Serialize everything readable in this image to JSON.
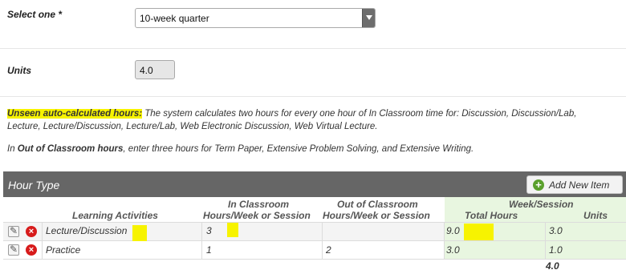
{
  "form": {
    "select_label": "Select one *",
    "select_value": "10-week quarter",
    "units_label": "Units",
    "units_value": "4.0"
  },
  "notes": {
    "unseen_title": "Unseen auto-calculated hours:",
    "unseen_line1": " The system calculates two hours for every one hour of In Classroom time for: Discussion, Discussion/Lab,",
    "unseen_line2": "Lecture, Lecture/Discussion, Lecture/Lab, Web Electronic Discussion, Web Virtual Lecture.",
    "out_prefix": "In ",
    "out_bold": "Out of Classroom hours",
    "out_rest": ", enter three hours for Term Paper, Extensive Problem Solving, and Extensive Writing."
  },
  "table": {
    "title": "Hour Type",
    "add_button": "Add New Item",
    "headers": {
      "learning": "Learning Activities",
      "in_class_1": "In Classroom",
      "in_class_2": "Hours/Week or Session",
      "out_class_1": "Out of Classroom",
      "out_class_2": "Hours/Week or Session",
      "total_1": "Week/Session",
      "total_2": "Total Hours",
      "units": "Units"
    },
    "rows": [
      {
        "activity": "Lecture/Discussion",
        "in_class": "3",
        "out_class": "",
        "total": "9.0",
        "units": "3.0"
      },
      {
        "activity": "Practice",
        "in_class": "1",
        "out_class": "2",
        "total": "3.0",
        "units": "1.0"
      }
    ],
    "units_total": "4.0"
  },
  "colors": {
    "highlight": "#f7f300",
    "header_bar": "#666666",
    "total_green": "#e8f6e0",
    "delete_red": "#d71b1b",
    "add_green": "#5aa02c"
  }
}
